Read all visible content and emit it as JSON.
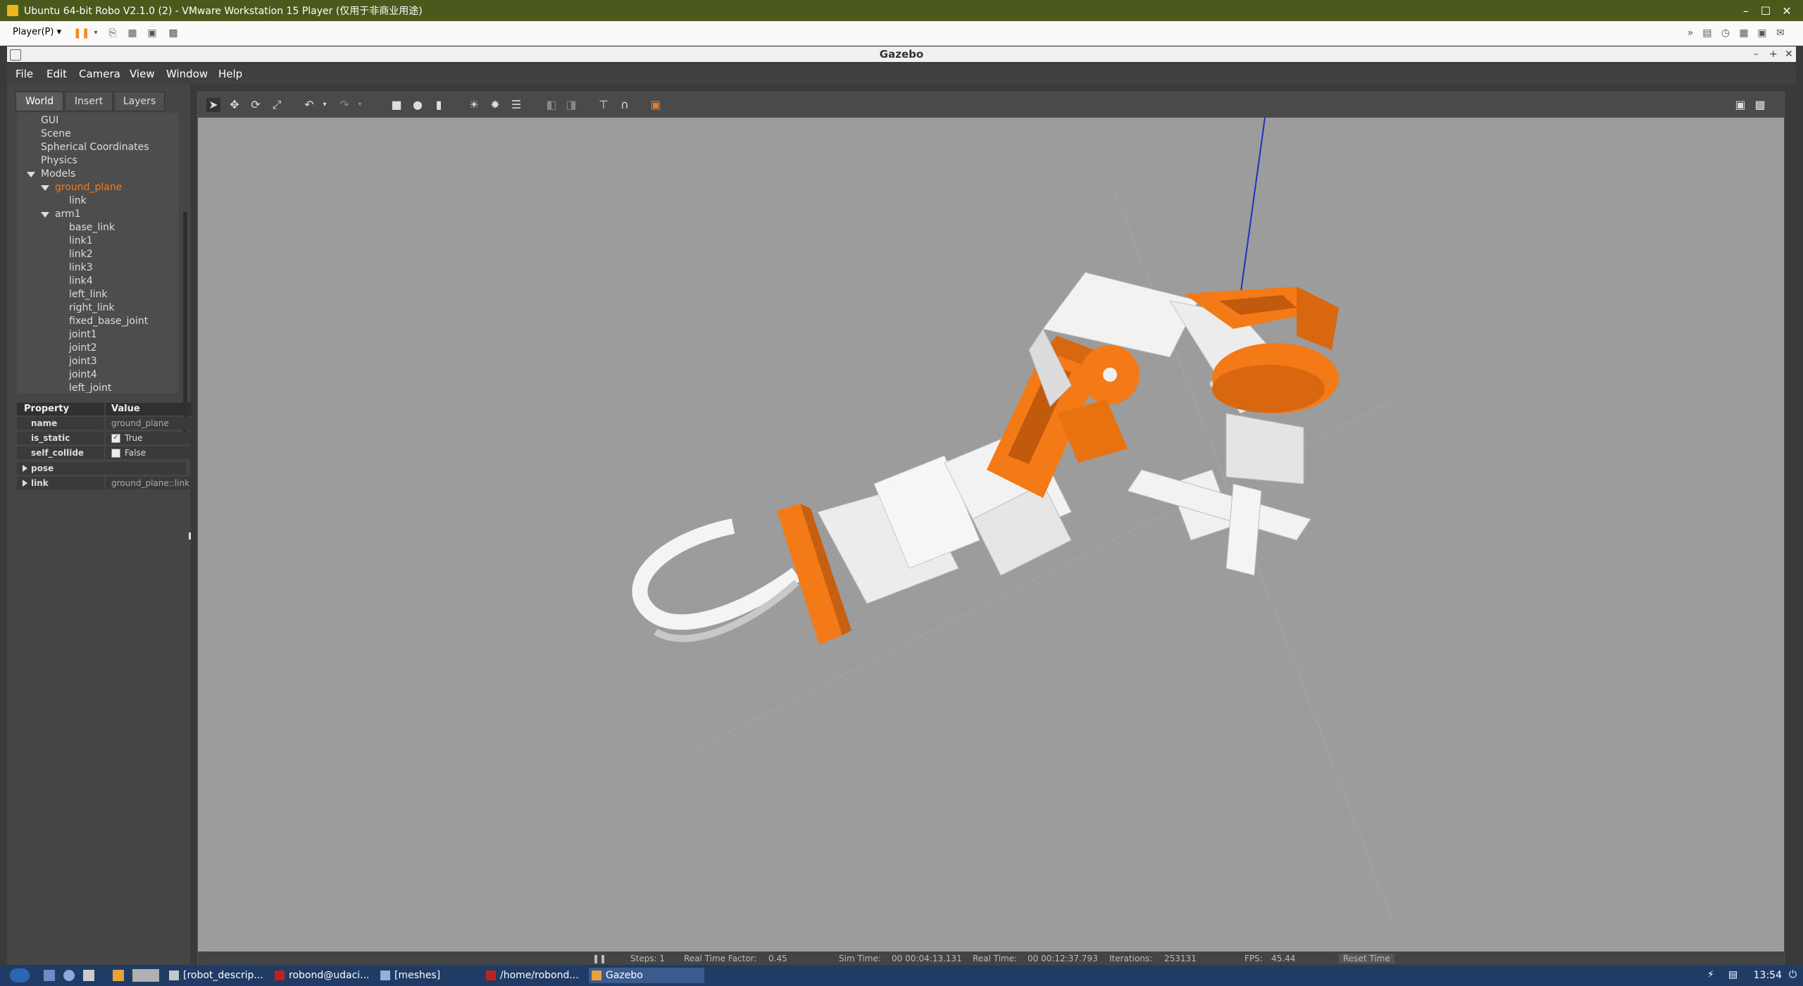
{
  "vm": {
    "title": "Ubuntu 64-bit Robo V2.1.0 (2) - VMware Workstation 15 Player (仅用于非商业用途)",
    "player_menu": "Player(P)"
  },
  "gazebo": {
    "window_title": "Gazebo",
    "menu": {
      "file": "File",
      "edit": "Edit",
      "camera": "Camera",
      "view": "View",
      "window": "Window",
      "help": "Help"
    },
    "tabs": {
      "world": "World",
      "insert": "Insert",
      "layers": "Layers"
    },
    "tree": {
      "gui": "GUI",
      "scene": "Scene",
      "spherical": "Spherical Coordinates",
      "physics": "Physics",
      "models": "Models",
      "ground_plane": "ground_plane",
      "gp_link": "link",
      "arm1": "arm1",
      "items": [
        "base_link",
        "link1",
        "link2",
        "link3",
        "link4",
        "left_link",
        "right_link",
        "fixed_base_joint",
        "joint1",
        "joint2",
        "joint3",
        "joint4",
        "left_joint"
      ]
    },
    "props": {
      "h_property": "Property",
      "h_value": "Value",
      "name_k": "name",
      "name_v": "ground_plane",
      "static_k": "is_static",
      "static_v": "True",
      "collide_k": "self_collide",
      "collide_v": "False",
      "pose_k": "pose",
      "link_k": "link",
      "link_v": "ground_plane::link"
    },
    "sim": {
      "steps": "Steps: 1",
      "rtf_label": "Real Time Factor:",
      "rtf": "0.45",
      "sim_time_label": "Sim Time:",
      "sim_time": "00 00:04:13.131",
      "real_time_label": "Real Time:",
      "real_time": "00 00:12:37.793",
      "iter_label": "Iterations:",
      "iter": "253131",
      "fps_label": "FPS:",
      "fps": "45.44",
      "reset": "Reset Time"
    }
  },
  "taskbar": {
    "items": [
      "[robot_descrip...",
      "robond@udaci...",
      "[meshes]",
      "/home/robond...",
      "Gazebo"
    ],
    "clock": "13:54"
  },
  "colors": {
    "accent": "#f47a18",
    "vm_title": "#4b5a1c",
    "viewport": "#9c9c9c"
  }
}
